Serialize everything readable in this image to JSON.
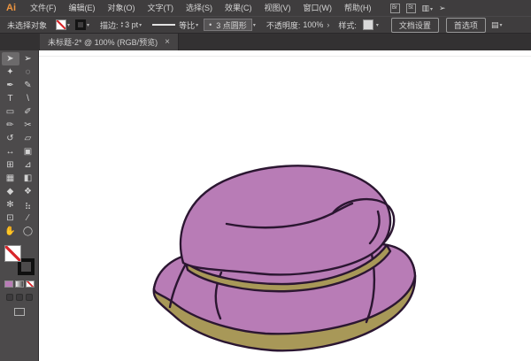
{
  "app": {
    "logo_text": "Ai"
  },
  "menu_bar": {
    "items": [
      "文件(F)",
      "编辑(E)",
      "对象(O)",
      "文字(T)",
      "选择(S)",
      "效果(C)",
      "视图(V)",
      "窗口(W)",
      "帮助(H)"
    ],
    "bridge_label": "Br",
    "stock_label": "St"
  },
  "control_bar": {
    "selection_status": "未选择对象",
    "stroke_label": "描边:",
    "stroke_weight": "3 pt",
    "stroke_profile": "等比",
    "brush_name": "3 点圆形",
    "opacity_label": "不透明度:",
    "opacity_value": "100%",
    "style_label": "样式:",
    "document_setup_label": "文档设置",
    "preferences_label": "首选项"
  },
  "tab": {
    "title": "未标题-2* @ 100% (RGB/预览)",
    "close": "×"
  },
  "toolbar": {
    "tools": [
      {
        "name": "selection-tool",
        "glyph": "➤",
        "selected": true
      },
      {
        "name": "direct-selection-tool",
        "glyph": "➢"
      },
      {
        "name": "magic-wand-tool",
        "glyph": "✦"
      },
      {
        "name": "lasso-tool",
        "glyph": "◌"
      },
      {
        "name": "pen-tool",
        "glyph": "✒"
      },
      {
        "name": "curvature-tool",
        "glyph": "✎"
      },
      {
        "name": "type-tool",
        "glyph": "T"
      },
      {
        "name": "line-segment-tool",
        "glyph": "\\"
      },
      {
        "name": "rectangle-tool",
        "glyph": "▭"
      },
      {
        "name": "paintbrush-tool",
        "glyph": "✐"
      },
      {
        "name": "pencil-tool",
        "glyph": "✏"
      },
      {
        "name": "eraser-tool",
        "glyph": "✂"
      },
      {
        "name": "rotate-tool",
        "glyph": "↺"
      },
      {
        "name": "scale-tool",
        "glyph": "▱"
      },
      {
        "name": "width-tool",
        "glyph": "↔"
      },
      {
        "name": "free-transform-tool",
        "glyph": "▣"
      },
      {
        "name": "shape-builder-tool",
        "glyph": "⊞"
      },
      {
        "name": "perspective-grid-tool",
        "glyph": "⊿"
      },
      {
        "name": "mesh-tool",
        "glyph": "▦"
      },
      {
        "name": "gradient-tool",
        "glyph": "◧"
      },
      {
        "name": "eyedropper-tool",
        "glyph": "◆"
      },
      {
        "name": "blend-tool",
        "glyph": "❖"
      },
      {
        "name": "symbol-sprayer-tool",
        "glyph": "✻"
      },
      {
        "name": "column-graph-tool",
        "glyph": "⣦"
      },
      {
        "name": "artboard-tool",
        "glyph": "⊡"
      },
      {
        "name": "slice-tool",
        "glyph": "∕"
      },
      {
        "name": "hand-tool",
        "glyph": "✋"
      },
      {
        "name": "zoom-tool",
        "glyph": "◯"
      }
    ]
  },
  "icons": {
    "chevron": "▾",
    "spinner_up": "▴",
    "spinner_down": "▾",
    "flyout": "›",
    "workspace": "▥",
    "share": "➢",
    "panel": "▤",
    "brush_dot": "•"
  },
  "canvas": {
    "artwork": "purple-steamed-bun-illustration",
    "zoom_level": "100%"
  },
  "colors": {
    "bun_purple": "#b87cb6",
    "bun_tan": "#a89858",
    "bun_outline": "#2b1631",
    "ui_bar": "#3f3d3e",
    "ui_tab_bar": "#333132",
    "ui_tab": "#454344",
    "ui_toolbar": "#4c4a4b",
    "ui_text": "#d4d4d4",
    "logo_orange": "#ee9540",
    "none_red": "#d8262a",
    "tool_selected": "#6c6a6b",
    "button_border": "#999999",
    "field_bg": "#565455",
    "swatch_style": "#d9d9d9",
    "canvas_white": "#ffffff"
  }
}
